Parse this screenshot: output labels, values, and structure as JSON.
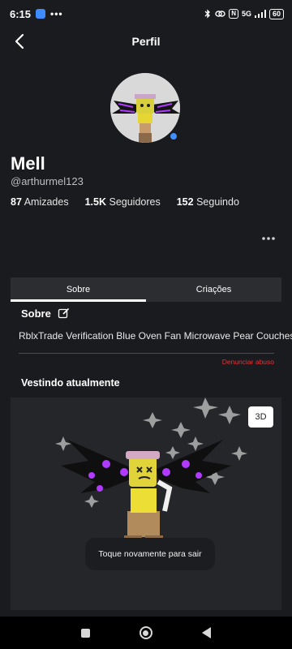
{
  "status_bar": {
    "time": "6:15",
    "dots": "•••",
    "network": "5G",
    "battery": "60"
  },
  "header": {
    "title": "Perfil"
  },
  "profile": {
    "name": "Mell",
    "handle": "@arthurmel123",
    "stats": [
      {
        "value": "87",
        "label": "Amizades"
      },
      {
        "value": "1.5K",
        "label": "Seguidores"
      },
      {
        "value": "152",
        "label": "Seguindo"
      }
    ]
  },
  "tabs": [
    {
      "label": "Sobre",
      "active": true
    },
    {
      "label": "Criações",
      "active": false
    }
  ],
  "about": {
    "title": "Sobre",
    "description": "RblxTrade Verification Blue Oven Fan Microwave Pear Couches",
    "report_label": "Denunciar abuso"
  },
  "wearing": {
    "title": "Vestindo atualmente",
    "btn_3d": "3D",
    "toast": "Toque novamente para sair"
  },
  "colors": {
    "background": "#191b1e",
    "accent_blue": "#3f8fff",
    "report_red": "#e0353b",
    "wings_purple": "#b03bff"
  }
}
